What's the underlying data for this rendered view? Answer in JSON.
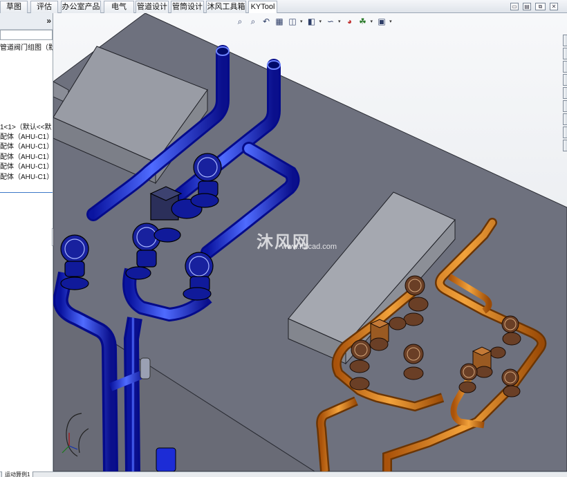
{
  "ribbon": {
    "tabs": [
      {
        "label": "草图"
      },
      {
        "label": "评估"
      },
      {
        "label": "办公室产品"
      },
      {
        "label": "电气"
      },
      {
        "label": "管道设计"
      },
      {
        "label": "管筒设计"
      },
      {
        "label": "沐风工具箱"
      },
      {
        "label": "KYTool"
      }
    ],
    "active_tab": "KYTool"
  },
  "window_controls": {
    "minimize_icon": "minimize-icon",
    "restore_icon": "restore-icon",
    "close_icon": "close-icon"
  },
  "feature_tree": {
    "collapse_label": "»",
    "assembly_label": "管道阀门组图（默",
    "component_label": "1<1>（默认<<默",
    "subassemblies": [
      "配体（AHU-C1）",
      "配体（AHU-C1）",
      "配体（AHU-C1）",
      "配体（AHU-C1）",
      "配体（AHU-C1）"
    ]
  },
  "heads_up_toolbar": {
    "icons": [
      "zoom-to-fit-icon",
      "zoom-to-area-icon",
      "previous-view-icon",
      "section-view-icon",
      "view-orientation-icon",
      "display-style-icon",
      "hide-show-items-icon",
      "edit-appearance-icon",
      "apply-scene-icon",
      "view-settings-icon"
    ]
  },
  "watermark": {
    "cn": "沐风网",
    "en": "www.mfcad.com"
  },
  "bottom_tabs": {
    "motion_study": "运动算例1"
  },
  "colors": {
    "background_top": "#f5f6f8",
    "floor": "#6f7280",
    "blue_pipe": "#1b2cff",
    "orange_pipe": "#e07d10",
    "valve_body": "#70442a"
  }
}
